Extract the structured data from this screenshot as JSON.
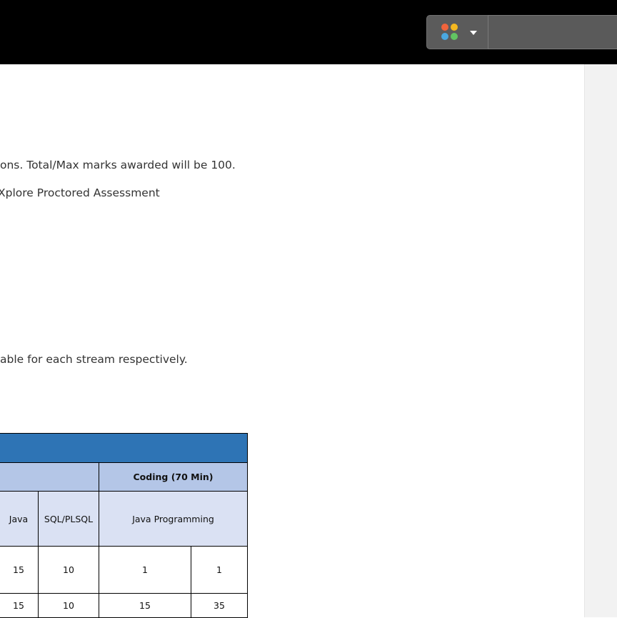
{
  "toolbar": {
    "addon_icon": "colored-dots-icon",
    "dropdown_icon": "caret-down-icon",
    "dot_colors": [
      "#f0643c",
      "#f5b820",
      "#4aa8e0",
      "#62c462"
    ]
  },
  "content": {
    "line1": "ons. Total/Max marks awarded will be 100.",
    "line2": "Xplore Proctored Assessment",
    "line3": "able for each stream respectively."
  },
  "table": {
    "coding_header": "Coding (70 Min)",
    "subheaders": [
      "Java",
      "SQL/PLSQL",
      "Java Programming"
    ],
    "row1": [
      "15",
      "10",
      "1",
      "1"
    ],
    "row2": [
      "15",
      "10",
      "15",
      "35"
    ]
  }
}
